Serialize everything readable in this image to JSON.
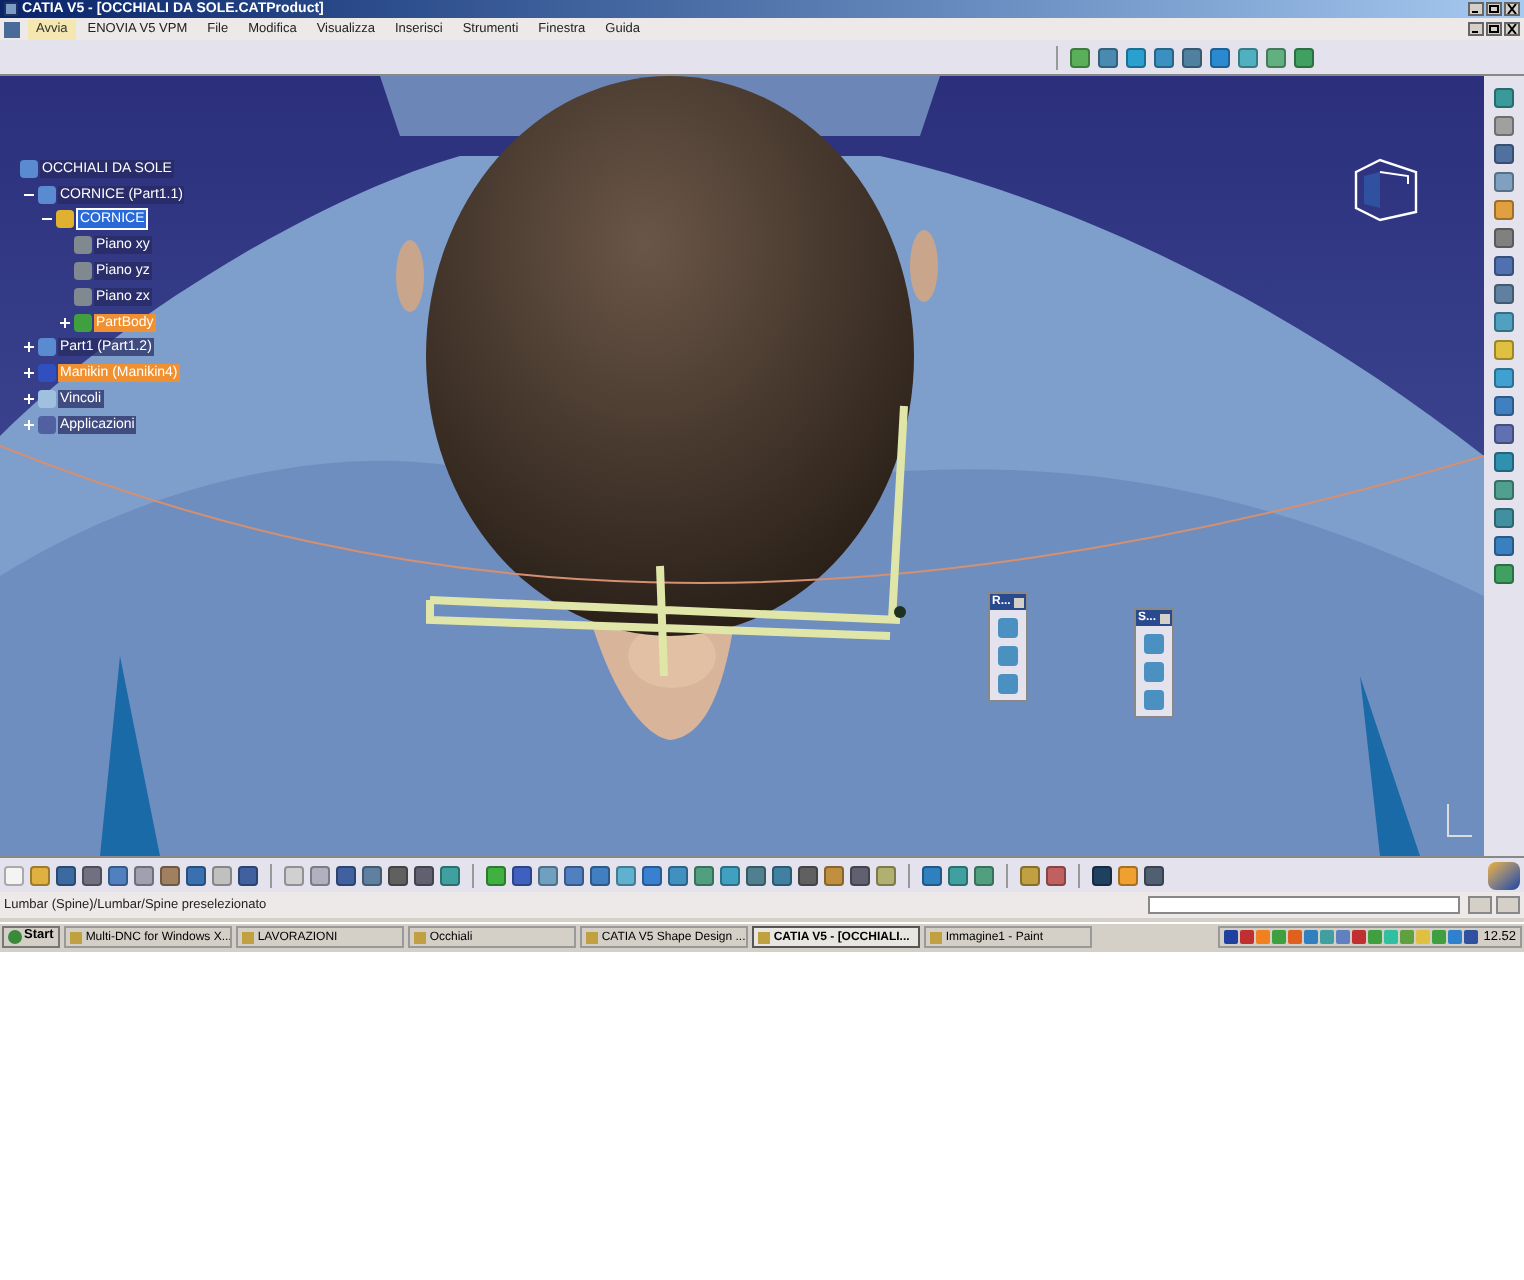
{
  "window": {
    "title": "CATIA V5 - [OCCHIALI DA SOLE.CATProduct]"
  },
  "menu": [
    {
      "label": "Avvia",
      "selected": true
    },
    {
      "label": "ENOVIA V5 VPM",
      "selected": false
    },
    {
      "label": "File",
      "selected": false
    },
    {
      "label": "Modifica",
      "selected": false
    },
    {
      "label": "Visualizza",
      "selected": false
    },
    {
      "label": "Inserisci",
      "selected": false
    },
    {
      "label": "Strumenti",
      "selected": false
    },
    {
      "label": "Finestra",
      "selected": false
    },
    {
      "label": "Guida",
      "selected": false
    }
  ],
  "tree": [
    {
      "label": "OCCHIALI DA SOLE",
      "kind": "product",
      "selected": false,
      "highlighted": false,
      "children": [
        {
          "label": "CORNICE (Part1.1)",
          "kind": "product",
          "selected": false,
          "highlighted": false,
          "expanded": true,
          "children": [
            {
              "label": "CORNICE",
              "kind": "part",
              "selected": true,
              "highlighted": false,
              "expanded": true,
              "children": [
                {
                  "label": "Piano xy",
                  "kind": "plane",
                  "selected": false,
                  "highlighted": false
                },
                {
                  "label": "Piano yz",
                  "kind": "plane",
                  "selected": false,
                  "highlighted": false
                },
                {
                  "label": "Piano zx",
                  "kind": "plane",
                  "selected": false,
                  "highlighted": false
                },
                {
                  "label": "PartBody",
                  "kind": "body",
                  "selected": false,
                  "highlighted": true,
                  "expanded": false
                }
              ]
            }
          ]
        },
        {
          "label": "Part1 (Part1.2)",
          "kind": "product",
          "selected": false,
          "highlighted": false,
          "expanded": false
        },
        {
          "label": "Manikin (Manikin4)",
          "kind": "manikin",
          "selected": false,
          "highlighted": true,
          "expanded": false
        },
        {
          "label": "Vincoli",
          "kind": "constraints",
          "selected": false,
          "highlighted": false,
          "expanded": false
        },
        {
          "label": "Applicazioni",
          "kind": "apps",
          "selected": false,
          "highlighted": false,
          "expanded": false
        }
      ]
    }
  ],
  "floating_toolbars": [
    {
      "title": "R..."
    },
    {
      "title": "S..."
    }
  ],
  "status_bar": {
    "text": "Lumbar (Spine)/Lumbar/Spine preselezionato"
  },
  "taskbar": {
    "start": "Start",
    "items": [
      {
        "label": "Multi-DNC for Windows X...",
        "selected": false
      },
      {
        "label": "LAVORAZIONI",
        "selected": false
      },
      {
        "label": "Occhiali",
        "selected": false
      },
      {
        "label": "CATIA V5 Shape Design ...",
        "selected": false
      },
      {
        "label": "CATIA V5 - [OCCHIALI...",
        "selected": true
      },
      {
        "label": "Immagine1 - Paint",
        "selected": false
      }
    ],
    "clock": "12.52"
  }
}
